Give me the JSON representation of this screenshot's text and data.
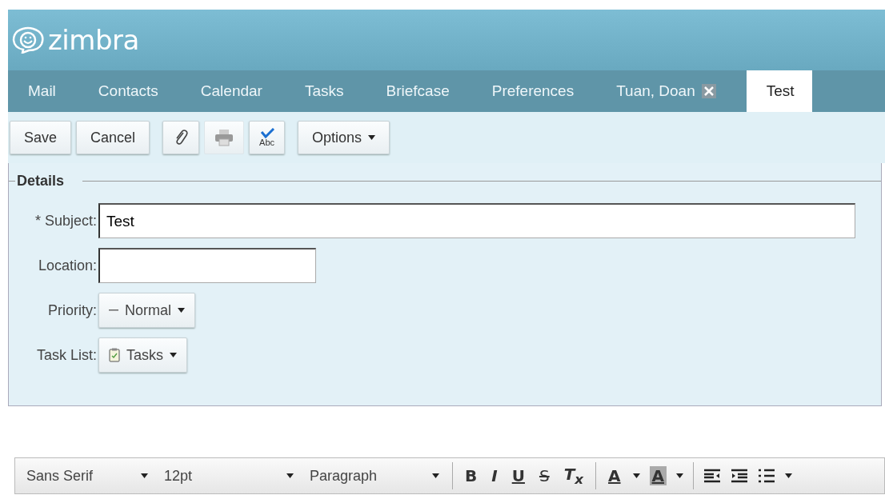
{
  "logo": {
    "text": "zimbra"
  },
  "tabs": [
    {
      "label": "Mail",
      "selected": false,
      "closable": false
    },
    {
      "label": "Contacts",
      "selected": false,
      "closable": false
    },
    {
      "label": "Calendar",
      "selected": false,
      "closable": false
    },
    {
      "label": "Tasks",
      "selected": false,
      "closable": false
    },
    {
      "label": "Briefcase",
      "selected": false,
      "closable": false
    },
    {
      "label": "Preferences",
      "selected": false,
      "closable": false
    },
    {
      "label": "Tuan, Doan",
      "selected": false,
      "closable": true
    },
    {
      "label": "Test",
      "selected": true,
      "closable": false
    }
  ],
  "toolbar": [
    {
      "kind": "text",
      "label": "Save",
      "disabled": false
    },
    {
      "kind": "text",
      "label": "Cancel",
      "disabled": false
    },
    {
      "kind": "attach",
      "disabled": false
    },
    {
      "kind": "print",
      "disabled": true
    },
    {
      "kind": "spell",
      "label": "Abc",
      "disabled": false
    },
    {
      "kind": "menu",
      "label": "Options",
      "disabled": false
    }
  ],
  "details": {
    "legend": "Details",
    "subject": {
      "label": "* Subject:",
      "value": "Test"
    },
    "location": {
      "label": "Location:"
    },
    "priority": {
      "label": "Priority:",
      "value": "Normal"
    },
    "task_list": {
      "label": "Task List:",
      "value": "Tasks"
    }
  },
  "editor_toolbar": {
    "font": "Sans Serif",
    "size": "12pt",
    "format": "Paragraph",
    "styles": [
      {
        "kind": "bold",
        "label": "B"
      },
      {
        "kind": "italic",
        "label": "I"
      },
      {
        "kind": "underline",
        "label": "U"
      },
      {
        "kind": "strike",
        "label": "S"
      },
      {
        "kind": "clear",
        "label": "T$_{x}$"
      }
    ],
    "text_color": "A",
    "highlight_color": "A"
  }
}
